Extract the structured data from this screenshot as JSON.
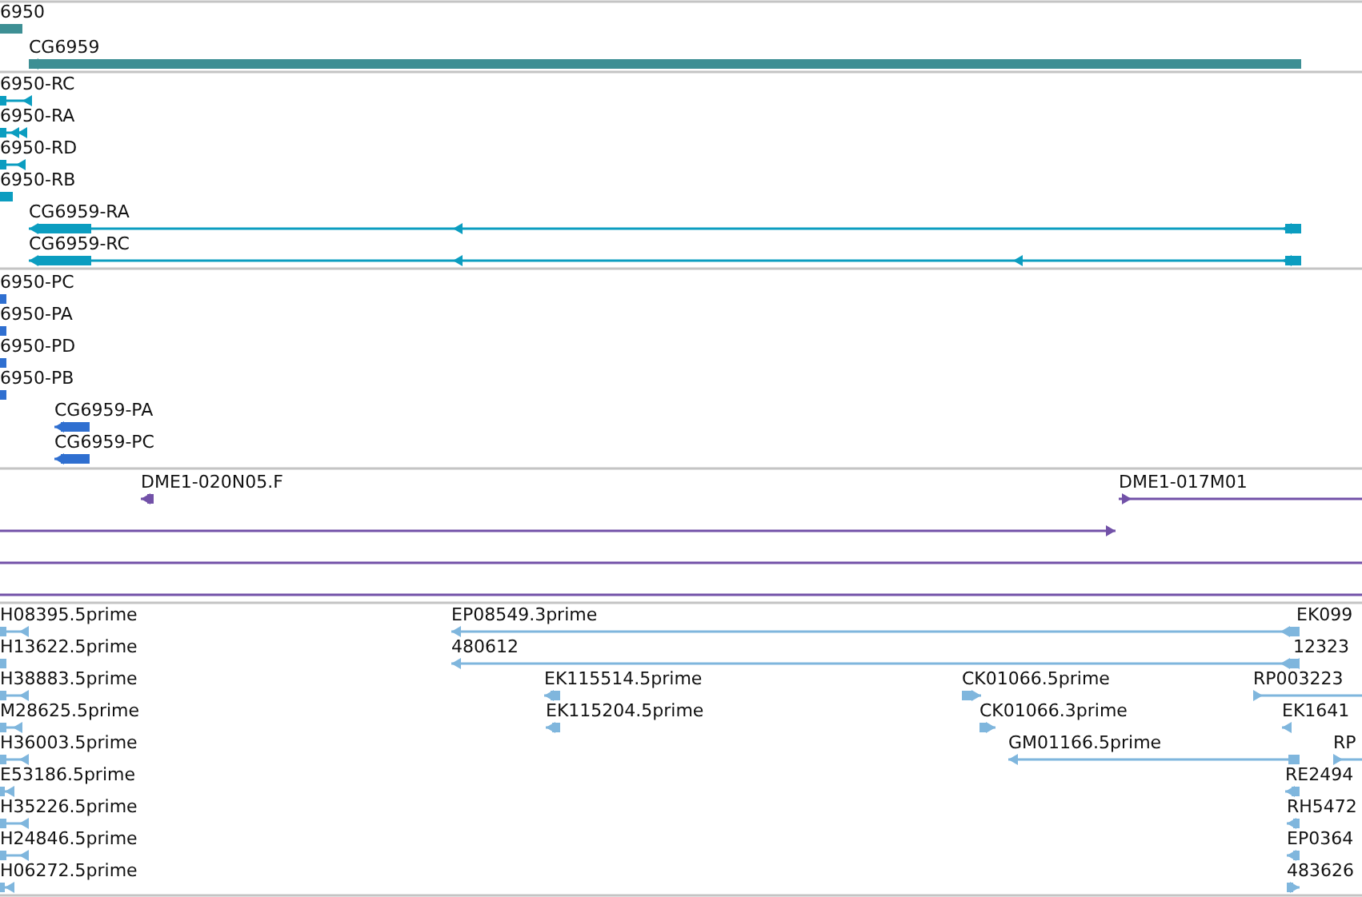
{
  "tracks": [
    {
      "color": "#3d8f94",
      "features": [
        {
          "label": "6950"
        },
        {
          "label": "CG6959",
          "reverse": true
        }
      ]
    },
    {
      "color": "#0b9dc0",
      "features": [
        {
          "label": "6950-RC",
          "reverse": true
        },
        {
          "label": "6950-RA",
          "reverse": true
        },
        {
          "label": "6950-RD",
          "reverse": true
        },
        {
          "label": "6950-RB"
        },
        {
          "label": "CG6959-RA",
          "reverse": true
        },
        {
          "label": "CG6959-RC",
          "reverse": true
        }
      ]
    },
    {
      "color": "#2f6fd0",
      "features": [
        {
          "label": "6950-PC"
        },
        {
          "label": "6950-PA"
        },
        {
          "label": "6950-PD"
        },
        {
          "label": "6950-PB"
        },
        {
          "label": "CG6959-PA",
          "reverse": true
        },
        {
          "label": "CG6959-PC",
          "reverse": true
        }
      ]
    },
    {
      "color": "#7251a8",
      "features": [
        {
          "kind": "feature",
          "label": "DME1-020N05.F",
          "reverse": true
        },
        {
          "kind": "feature",
          "label": "DME1-017M01",
          "reverse": false
        },
        {
          "kind": "line",
          "reverse": false
        },
        {
          "kind": "line"
        },
        {
          "kind": "line"
        }
      ]
    },
    {
      "color": "#7fb6dd",
      "features": [
        {
          "label": "H08395.5prime",
          "reverse": true
        },
        {
          "label": "H13622.5prime"
        },
        {
          "label": "H38883.5prime",
          "reverse": true
        },
        {
          "label": "M28625.5prime",
          "reverse": true
        },
        {
          "label": "H36003.5prime",
          "reverse": true
        },
        {
          "label": "E53186.5prime",
          "reverse": true
        },
        {
          "label": "H35226.5prime",
          "reverse": true
        },
        {
          "label": "H24846.5prime",
          "reverse": true
        },
        {
          "label": "H06272.5prime",
          "reverse": true
        },
        {
          "label": "EP08549.3prime",
          "reverse": true
        },
        {
          "label": "480612",
          "reverse": true
        },
        {
          "label": "EK115514.5prime",
          "reverse": true
        },
        {
          "label": "EK115204.5prime",
          "reverse": true
        },
        {
          "label": "CK01066.5prime",
          "reverse": false
        },
        {
          "label": "CK01066.3prime",
          "reverse": false
        },
        {
          "label": "GM01166.5prime",
          "reverse": true
        },
        {
          "label": "EK099"
        },
        {
          "label": "12323"
        },
        {
          "label": "RP003223",
          "reverse": false
        },
        {
          "label": "EK1641",
          "reverse": true
        },
        {
          "label": "RP",
          "reverse": false
        },
        {
          "label": "RE2494",
          "reverse": true
        },
        {
          "label": "RH5472",
          "reverse": true
        },
        {
          "label": "EP0364",
          "reverse": true
        },
        {
          "label": "483626",
          "reverse": false
        }
      ]
    }
  ]
}
